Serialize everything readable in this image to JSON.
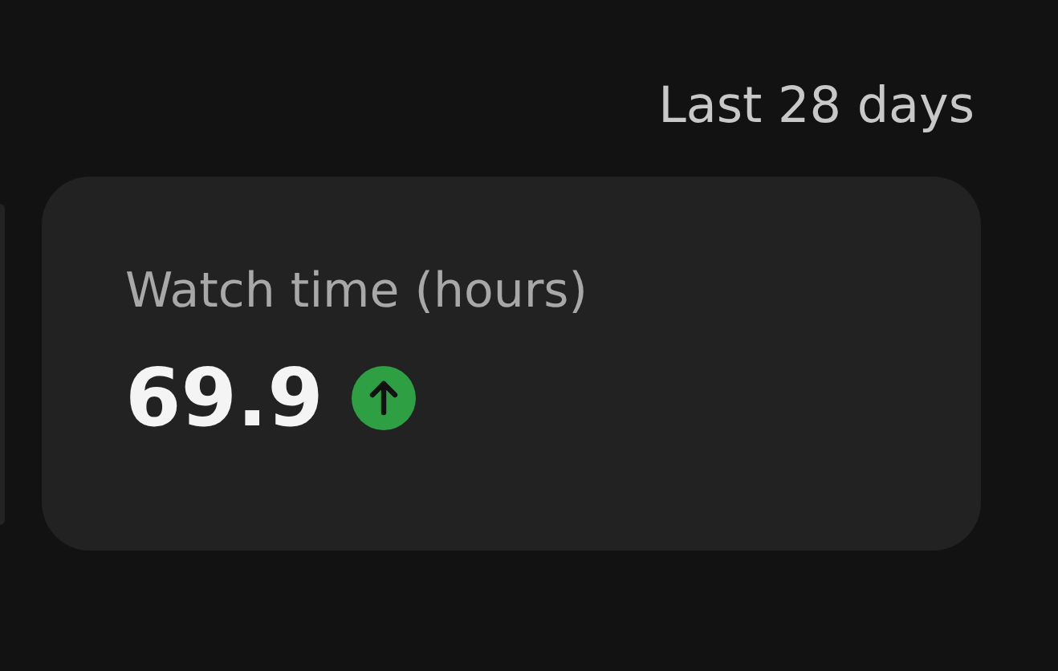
{
  "period": "Last 28 days",
  "metric": {
    "label": "Watch time (hours)",
    "value": "69.9",
    "rising": true
  }
}
